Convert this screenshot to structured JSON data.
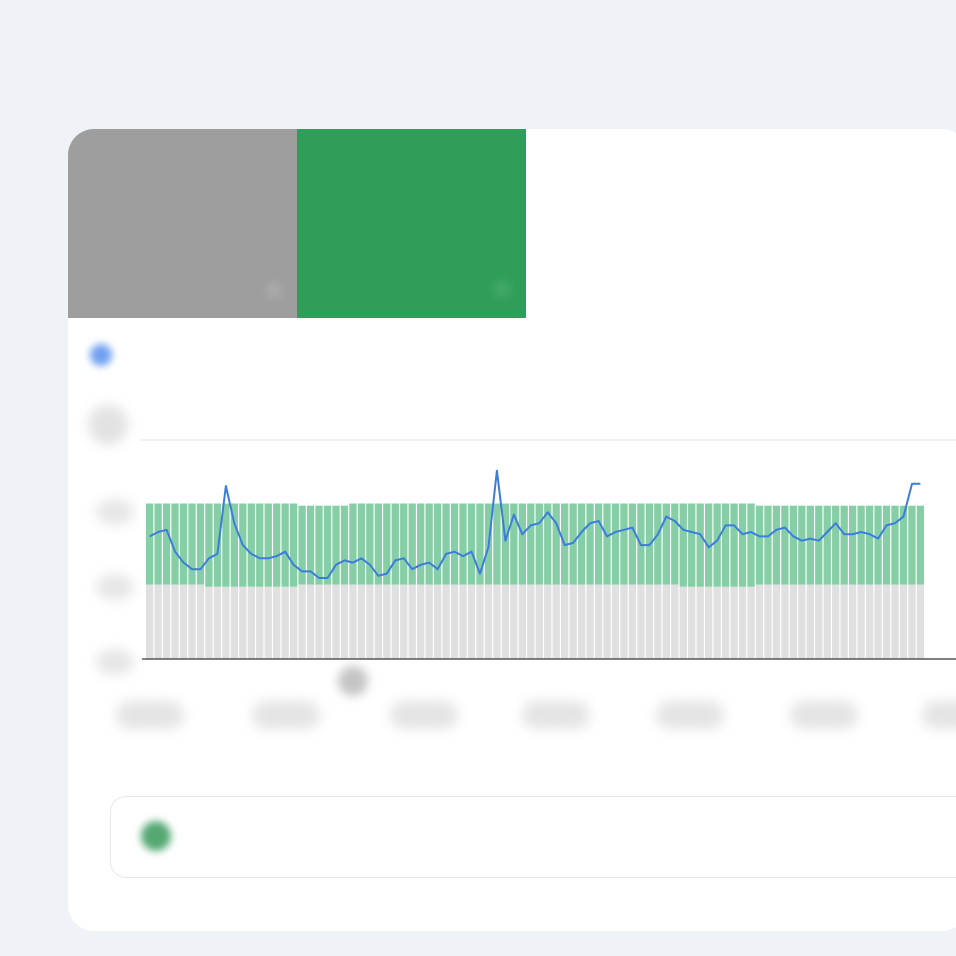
{
  "tiles": [
    {
      "label": "",
      "value": "",
      "sub": "",
      "color": "#9e9e9e"
    },
    {
      "label": "",
      "value": "",
      "sub": "",
      "color": "#2e9e58"
    }
  ],
  "legend": {
    "text": "",
    "color": "#6ea0f0"
  },
  "note": {
    "text": "",
    "icon": "info-icon"
  },
  "colors": {
    "bar_base": "#e0e0e0",
    "bar_top": "#86cfa6",
    "line": "#3b7ddd",
    "background": "#eff3f8",
    "card": "#ffffff"
  },
  "chart_data": {
    "type": "bar",
    "title": "",
    "xlabel": "",
    "ylabel": "",
    "ylim": [
      0,
      100
    ],
    "grid": false,
    "legend": "top-left",
    "x_tick_labels": [
      "",
      "",
      "",
      "",
      "",
      "",
      ""
    ],
    "y_tick_labels": [
      "",
      "",
      ""
    ],
    "x": [
      1,
      2,
      3,
      4,
      5,
      6,
      7,
      8,
      9,
      10,
      11,
      12,
      13,
      14,
      15,
      16,
      17,
      18,
      19,
      20,
      21,
      22,
      23,
      24,
      25,
      26,
      27,
      28,
      29,
      30,
      31,
      32,
      33,
      34,
      35,
      36,
      37,
      38,
      39,
      40,
      41,
      42,
      43,
      44,
      45,
      46,
      47,
      48,
      49,
      50,
      51,
      52,
      53,
      54,
      55,
      56,
      57,
      58,
      59,
      60,
      61,
      62,
      63,
      64,
      65,
      66,
      67,
      68,
      69,
      70,
      71,
      72,
      73,
      74,
      75,
      76,
      77,
      78,
      79,
      80,
      81,
      82,
      83,
      84,
      85,
      86,
      87,
      88,
      89,
      90,
      91,
      92
    ],
    "series": [
      {
        "name": "",
        "kind": "bar",
        "color": "#e0e0e0",
        "values": [
          34,
          34,
          34,
          34,
          34,
          34,
          34,
          33,
          33,
          33,
          33,
          33,
          33,
          33,
          33,
          33,
          33,
          33,
          34,
          34,
          34,
          34,
          34,
          34,
          34,
          34,
          34,
          34,
          34,
          34,
          34,
          34,
          34,
          34,
          34,
          34,
          34,
          34,
          34,
          34,
          34,
          34,
          34,
          34,
          34,
          34,
          34,
          34,
          34,
          34,
          34,
          34,
          34,
          34,
          34,
          34,
          34,
          34,
          34,
          34,
          34,
          34,
          34,
          33,
          33,
          33,
          33,
          33,
          33,
          33,
          33,
          33,
          34,
          34,
          34,
          34,
          34,
          34,
          34,
          34,
          34,
          34,
          34,
          34,
          34,
          34,
          34,
          34,
          34,
          34,
          34,
          34
        ]
      },
      {
        "name": "",
        "kind": "bar",
        "color": "#86cfa6",
        "values": [
          37,
          37,
          37,
          37,
          37,
          37,
          37,
          38,
          38,
          38,
          38,
          38,
          38,
          38,
          38,
          38,
          38,
          38,
          36,
          36,
          36,
          36,
          36,
          36,
          37,
          37,
          37,
          37,
          37,
          37,
          37,
          37,
          37,
          37,
          37,
          37,
          37,
          37,
          37,
          37,
          37,
          37,
          37,
          37,
          37,
          37,
          37,
          37,
          37,
          37,
          37,
          37,
          37,
          37,
          37,
          37,
          37,
          37,
          37,
          37,
          37,
          37,
          37,
          38,
          38,
          38,
          38,
          38,
          38,
          38,
          38,
          38,
          36,
          36,
          36,
          36,
          36,
          36,
          36,
          36,
          36,
          36,
          36,
          36,
          36,
          36,
          36,
          36,
          36,
          36,
          36,
          36
        ]
      },
      {
        "name": "",
        "kind": "line",
        "color": "#3b7ddd",
        "values": [
          56,
          58,
          59,
          49,
          44,
          41,
          41,
          46,
          48,
          79,
          62,
          52,
          48,
          46,
          46,
          47,
          49,
          43,
          40,
          40,
          37,
          37,
          43,
          45,
          44,
          46,
          43,
          38,
          39,
          45,
          46,
          41,
          43,
          44,
          41,
          48,
          49,
          47,
          49,
          39,
          51,
          86,
          54,
          66,
          57,
          61,
          62,
          67,
          62,
          52,
          53,
          58,
          62,
          63,
          56,
          58,
          59,
          60,
          52,
          52,
          57,
          65,
          63,
          59,
          58,
          57,
          51,
          54,
          61,
          61,
          57,
          58,
          56,
          56,
          59,
          60,
          56,
          54,
          55,
          54,
          58,
          62,
          57,
          57,
          58,
          57,
          55,
          61,
          62,
          65,
          80,
          80
        ]
      }
    ]
  }
}
